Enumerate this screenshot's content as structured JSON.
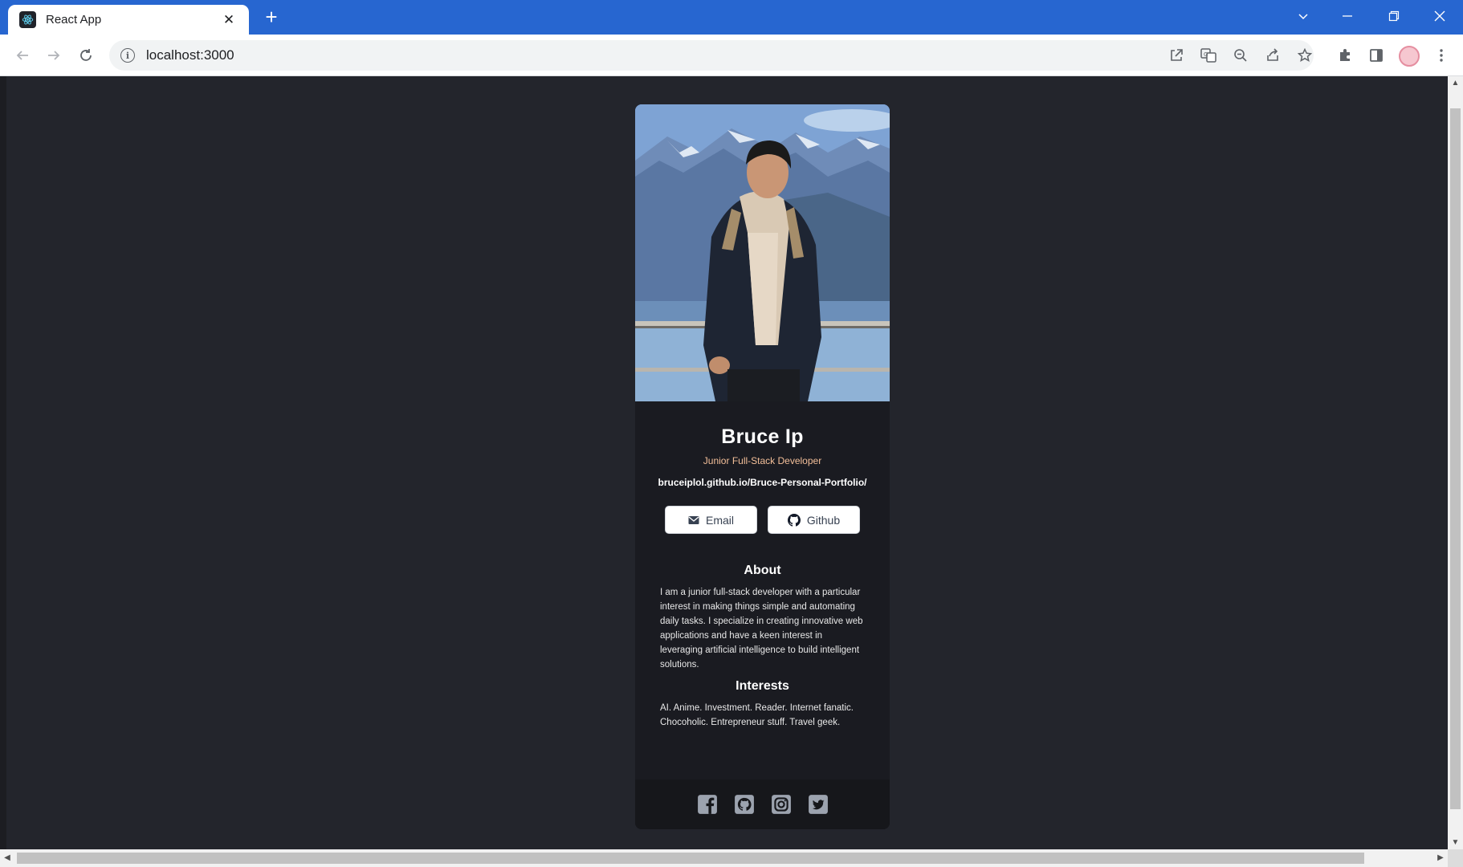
{
  "browser": {
    "tab_title": "React App",
    "tab_close": "✕",
    "new_tab": "+",
    "url": "localhost:3000"
  },
  "profile": {
    "name": "Bruce Ip",
    "role": "Junior Full-Stack Developer",
    "website": "bruceiplol.github.io/Bruce-Personal-Portfolio/",
    "buttons": {
      "email": "Email",
      "github": "Github"
    },
    "about_title": "About",
    "about_text": "I am a junior full-stack developer with a particular interest in making things simple and automating daily tasks. I specialize in creating innovative web applications and have a keen interest in leveraging artificial intelligence to build intelligent solutions.",
    "interests_title": "Interests",
    "interests_text": "AI. Anime. Investment. Reader. Internet fanatic. Chocoholic. Entrepreneur stuff. Travel geek."
  },
  "colors": {
    "page_bg": "#23252c",
    "card_bg": "#1a1b21",
    "footer_bg": "#16171b",
    "role_accent": "#f3bf99",
    "browser_blue": "#2766d0"
  },
  "social_icons": [
    "facebook-icon",
    "github-icon",
    "instagram-icon",
    "twitter-icon"
  ]
}
